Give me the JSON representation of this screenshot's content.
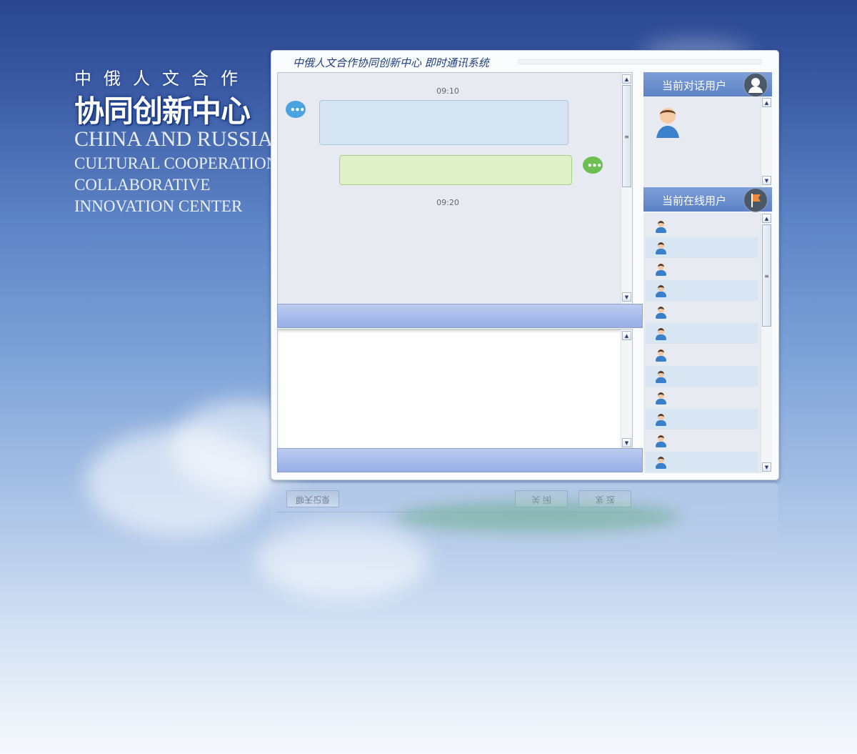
{
  "brand": {
    "cn_small": "中俄人文合作",
    "cn_big": "协同创新中心",
    "en_line1": "CHINA AND RUSSIA",
    "en_line2": "CULTURAL COOPERATION",
    "en_line3": "COLLABORATIVE",
    "en_line4": "INNOVATION CENTER"
  },
  "window": {
    "title": "中俄人文合作协同创新中心 即时通讯系统"
  },
  "chat": {
    "messages": [
      {
        "time": "09:10",
        "direction": "incoming",
        "text": ""
      },
      {
        "direction": "outgoing",
        "text": ""
      }
    ],
    "second_time": "09:20"
  },
  "sidebar": {
    "current_label": "当前对话用户",
    "online_label": "当前在线用户",
    "online_users_count_visible": 12
  },
  "reflection": {
    "btn_left": "聊天记录",
    "btn_mid": "关 闭",
    "btn_right": "发 送"
  },
  "colors": {
    "accent": "#5c82c6",
    "incoming_bubble": "#d5e5f4",
    "outgoing_bubble": "#def1c9"
  }
}
